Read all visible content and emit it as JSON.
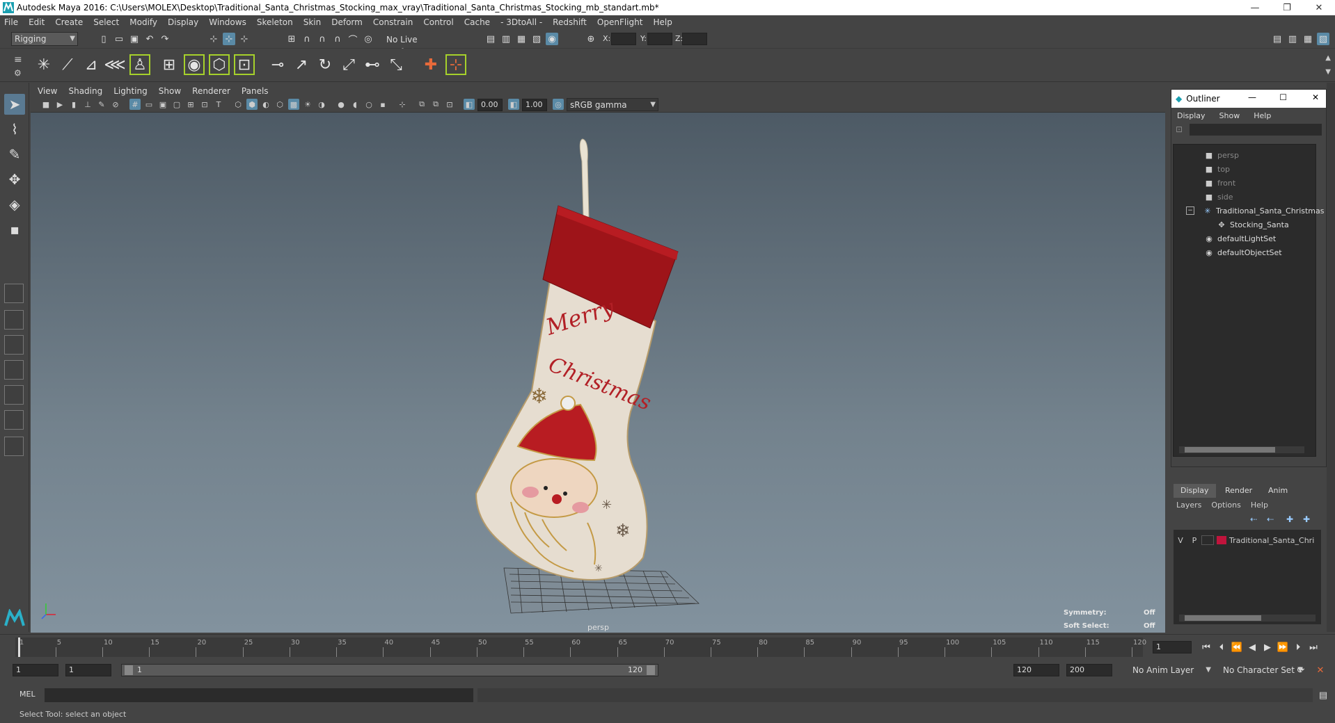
{
  "window": {
    "title": "Autodesk Maya 2016: C:\\Users\\MOLEX\\Desktop\\Traditional_Santa_Christmas_Stocking_max_vray\\Traditional_Santa_Christmas_Stocking_mb_standart.mb*",
    "controls": [
      "—",
      "❐",
      "✕"
    ]
  },
  "menubar": [
    "File",
    "Edit",
    "Create",
    "Select",
    "Modify",
    "Display",
    "Windows",
    "Skeleton",
    "Skin",
    "Deform",
    "Constrain",
    "Control",
    "Cache",
    "- 3DtoAll -",
    "Redshift",
    "OpenFlight",
    "Help"
  ],
  "statusline": {
    "mode": "Rigging",
    "live_surface": "No Live Surface",
    "x_label": "X:",
    "y_label": "Y:",
    "z_label": "Z:"
  },
  "viewport": {
    "menu": [
      "View",
      "Shading",
      "Lighting",
      "Show",
      "Renderer",
      "Panels"
    ],
    "exposure": "0.00",
    "gamma": "1.00",
    "color_space": "sRGB gamma",
    "camera_label": "persp",
    "symmetry_label": "Symmetry:",
    "symmetry_value": "Off",
    "soft_select_label": "Soft Select:",
    "soft_select_value": "Off",
    "stocking_text_1": "Merry",
    "stocking_text_2": "Christmas"
  },
  "outliner": {
    "title": "Outliner",
    "menu": [
      "Display",
      "Show",
      "Help"
    ],
    "items": [
      {
        "label": "persp",
        "type": "camera",
        "dim": true
      },
      {
        "label": "top",
        "type": "camera",
        "dim": true
      },
      {
        "label": "front",
        "type": "camera",
        "dim": true
      },
      {
        "label": "side",
        "type": "camera",
        "dim": true
      },
      {
        "label": "Traditional_Santa_Christmas",
        "type": "group",
        "dim": false
      },
      {
        "label": "Stocking_Santa",
        "type": "mesh",
        "dim": false
      },
      {
        "label": "defaultLightSet",
        "type": "set",
        "dim": false
      },
      {
        "label": "defaultObjectSet",
        "type": "set",
        "dim": false
      }
    ]
  },
  "layer_editor": {
    "tabs": [
      "Display",
      "Render",
      "Anim"
    ],
    "menu": [
      "Layers",
      "Options",
      "Help"
    ],
    "layer": {
      "v": "V",
      "p": "P",
      "name": "Traditional_Santa_Chri",
      "color": "#c0143c"
    }
  },
  "timeline": {
    "ticks": [
      "1",
      "5",
      "10",
      "15",
      "20",
      "25",
      "30",
      "35",
      "40",
      "45",
      "50",
      "55",
      "60",
      "65",
      "70",
      "75",
      "80",
      "85",
      "90",
      "95",
      "100",
      "105",
      "110",
      "115",
      "120"
    ],
    "current_frame": "1"
  },
  "range": {
    "start": "1",
    "playback_start": "1",
    "slider_start": "1",
    "slider_end": "120",
    "playback_end": "120",
    "end": "200",
    "anim_layer": "No Anim Layer",
    "character_set": "No Character Set"
  },
  "cmdline": {
    "label": "MEL"
  },
  "helpline": {
    "text": "Select Tool: select an object"
  }
}
